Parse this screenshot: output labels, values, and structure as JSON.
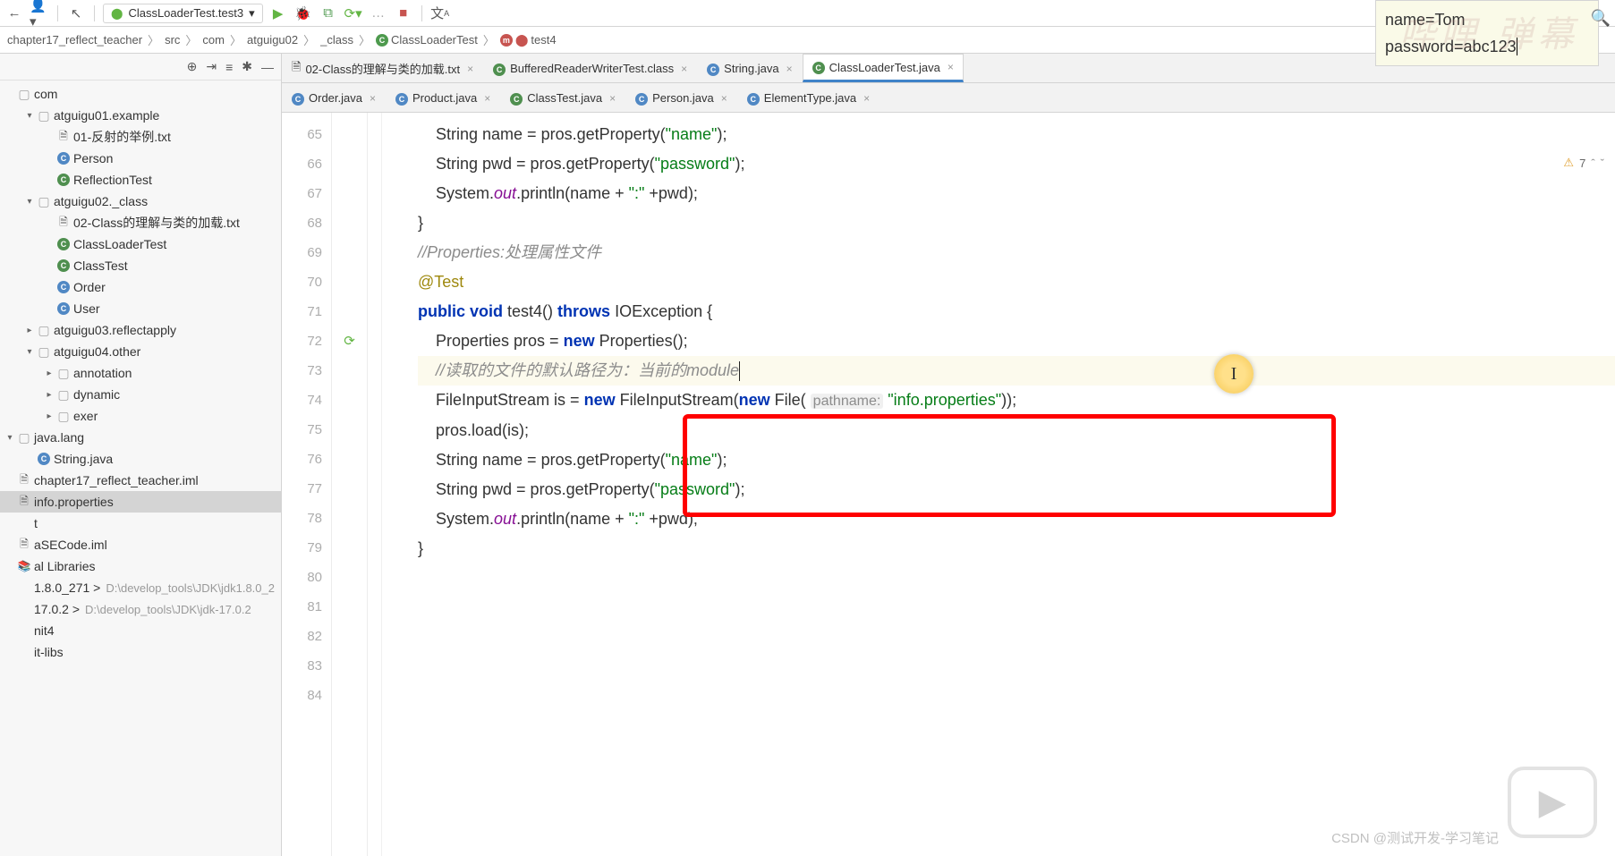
{
  "toolbar": {
    "runConfig": "ClassLoaderTest.test3"
  },
  "breadcrumb": {
    "items": [
      "chapter17_reflect_teacher",
      "src",
      "com",
      "atguigu02",
      "_class",
      "ClassLoaderTest",
      "test4"
    ]
  },
  "sidebar": {
    "tree": [
      {
        "depth": 0,
        "chev": "",
        "icon": "pkg",
        "label": "com"
      },
      {
        "depth": 1,
        "chev": "▾",
        "icon": "pkg",
        "label": "atguigu01.example"
      },
      {
        "depth": 2,
        "chev": "",
        "icon": "file",
        "label": "01-反射的举例.txt"
      },
      {
        "depth": 2,
        "chev": "",
        "icon": "cls",
        "label": "Person"
      },
      {
        "depth": 2,
        "chev": "",
        "icon": "cc",
        "label": "ReflectionTest"
      },
      {
        "depth": 1,
        "chev": "▾",
        "icon": "pkg",
        "label": "atguigu02._class"
      },
      {
        "depth": 2,
        "chev": "",
        "icon": "file",
        "label": "02-Class的理解与类的加载.txt"
      },
      {
        "depth": 2,
        "chev": "",
        "icon": "cc",
        "label": "ClassLoaderTest"
      },
      {
        "depth": 2,
        "chev": "",
        "icon": "cc",
        "label": "ClassTest"
      },
      {
        "depth": 2,
        "chev": "",
        "icon": "cls",
        "label": "Order"
      },
      {
        "depth": 2,
        "chev": "",
        "icon": "cls",
        "label": "User"
      },
      {
        "depth": 1,
        "chev": "▸",
        "icon": "pkg",
        "label": "atguigu03.reflectapply"
      },
      {
        "depth": 1,
        "chev": "▾",
        "icon": "pkg",
        "label": "atguigu04.other"
      },
      {
        "depth": 2,
        "chev": "▸",
        "icon": "pkg",
        "label": "annotation"
      },
      {
        "depth": 2,
        "chev": "▸",
        "icon": "pkg",
        "label": "dynamic"
      },
      {
        "depth": 2,
        "chev": "▸",
        "icon": "pkg",
        "label": "exer"
      },
      {
        "depth": 0,
        "chev": "▾",
        "icon": "pkg",
        "label": "java.lang"
      },
      {
        "depth": 1,
        "chev": "",
        "icon": "cls",
        "label": "String.java"
      },
      {
        "depth": 0,
        "chev": "",
        "icon": "file",
        "label": "chapter17_reflect_teacher.iml"
      },
      {
        "depth": 0,
        "chev": "",
        "icon": "file",
        "label": "info.properties",
        "selected": true
      },
      {
        "depth": 0,
        "chev": "",
        "icon": "",
        "label": "t"
      },
      {
        "depth": 0,
        "chev": "",
        "icon": "file",
        "label": "aSECode.iml"
      },
      {
        "depth": 0,
        "chev": "",
        "icon": "lib",
        "label": "al Libraries"
      },
      {
        "depth": 0,
        "chev": "",
        "icon": "",
        "label": "1.8.0_271 >",
        "hint": "D:\\develop_tools\\JDK\\jdk1.8.0_2"
      },
      {
        "depth": 0,
        "chev": "",
        "icon": "",
        "label": "17.0.2 >",
        "hint": "D:\\develop_tools\\JDK\\jdk-17.0.2"
      },
      {
        "depth": 0,
        "chev": "",
        "icon": "",
        "label": "nit4"
      },
      {
        "depth": 0,
        "chev": "",
        "icon": "",
        "label": "it-libs"
      }
    ]
  },
  "tabs": {
    "row1": [
      {
        "icon": "file",
        "label": "02-Class的理解与类的加载.txt",
        "closable": true
      },
      {
        "icon": "cc",
        "label": "BufferedReaderWriterTest.class",
        "closable": true
      },
      {
        "icon": "cls",
        "label": "String.java",
        "closable": true
      },
      {
        "icon": "cc",
        "label": "ClassLoaderTest.java",
        "closable": true,
        "active": true
      }
    ],
    "row2": [
      {
        "icon": "cls",
        "label": "Order.java",
        "closable": true
      },
      {
        "icon": "cls",
        "label": "Product.java",
        "closable": true
      },
      {
        "icon": "cc",
        "label": "ClassTest.java",
        "closable": true
      },
      {
        "icon": "cls",
        "label": "Person.java",
        "closable": true
      },
      {
        "icon": "cls",
        "label": "ElementType.java",
        "closable": true
      }
    ]
  },
  "code": {
    "lines": [
      {
        "n": 65,
        "t": "    String name = pros.getProperty(\"name\");"
      },
      {
        "n": 66,
        "t": "    String pwd = pros.getProperty(\"password\");"
      },
      {
        "n": 67,
        "t": "    System.out.println(name + \":\" +pwd);"
      },
      {
        "n": 68,
        "t": "}"
      },
      {
        "n": 69,
        "t": ""
      },
      {
        "n": 70,
        "t": "//Properties:处理属性文件",
        "cmt": true
      },
      {
        "n": 71,
        "t": "@Test",
        "ann": true
      },
      {
        "n": 72,
        "t": "public void test4() throws IOException {",
        "marker": "run"
      },
      {
        "n": 73,
        "t": "    Properties pros = new Properties();"
      },
      {
        "n": 74,
        "t": ""
      },
      {
        "n": 75,
        "t": "    //读取的文件的默认路径为：当前的module",
        "cmt": true,
        "hl": true,
        "caret": true
      },
      {
        "n": 76,
        "t": "    FileInputStream is = new FileInputStream(new File( pathname: \"info.properties\"));"
      },
      {
        "n": 77,
        "t": ""
      },
      {
        "n": 78,
        "t": "    pros.load(is);"
      },
      {
        "n": 79,
        "t": ""
      },
      {
        "n": 80,
        "t": "    String name = pros.getProperty(\"name\");"
      },
      {
        "n": 81,
        "t": "    String pwd = pros.getProperty(\"password\");"
      },
      {
        "n": 82,
        "t": "    System.out.println(name + \":\" +pwd);"
      },
      {
        "n": 83,
        "t": ""
      },
      {
        "n": 84,
        "t": "}"
      }
    ]
  },
  "floatBox": {
    "line1": "name=Tom",
    "line2": "password=abc123"
  },
  "info": {
    "warnCount": "7"
  },
  "watermark": {
    "csdn": "CSDN @测试开发-学习笔记"
  }
}
